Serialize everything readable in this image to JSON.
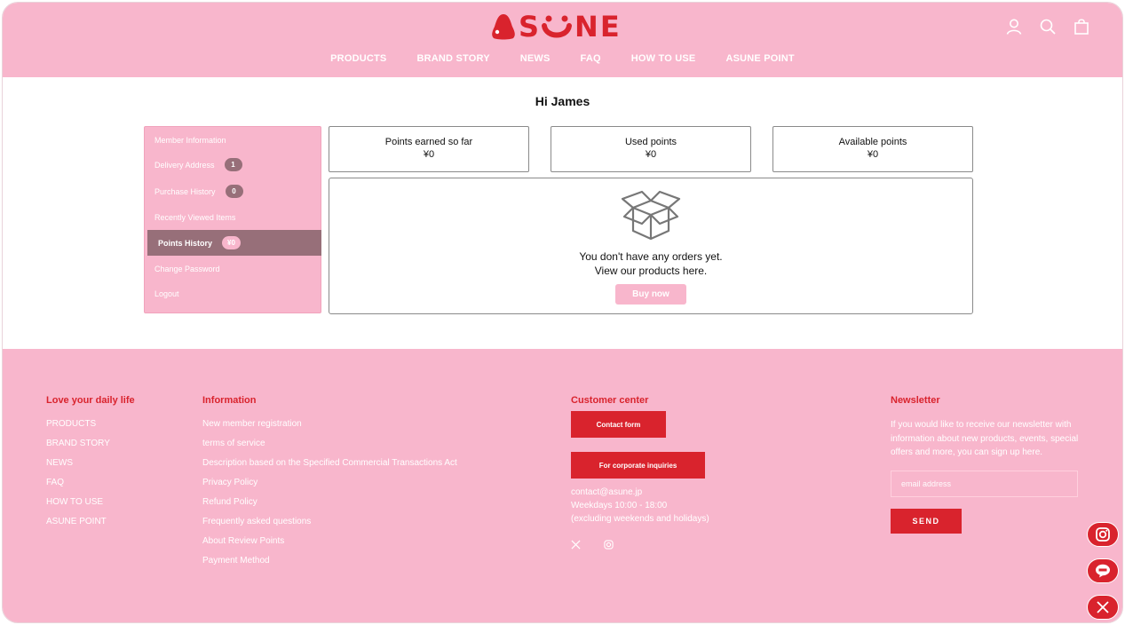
{
  "header": {
    "logo_text": "SNE",
    "logo_full": "ASUNE",
    "nav": [
      "PRODUCTS",
      "BRAND STORY",
      "NEWS",
      "FAQ",
      "HOW TO USE",
      "ASUNE POINT"
    ],
    "icons": [
      "user-icon",
      "search-icon",
      "shopping-bag-icon"
    ]
  },
  "main": {
    "greeting": "Hi James",
    "sidebar": [
      {
        "label": "Member Information",
        "badge": null
      },
      {
        "label": "Delivery Address",
        "badge": "1"
      },
      {
        "label": "Purchase History",
        "badge": "0"
      },
      {
        "label": "Recently Viewed Items",
        "badge": null
      },
      {
        "label": "Points History",
        "badge": "¥0",
        "active": true
      },
      {
        "label": "Change Password",
        "badge": null
      },
      {
        "label": "Logout",
        "badge": null
      }
    ],
    "stats": [
      {
        "label": "Points earned so far",
        "value": "¥0"
      },
      {
        "label": "Used points",
        "value": "¥0"
      },
      {
        "label": "Available points",
        "value": "¥0"
      }
    ],
    "orders": {
      "empty_line1": "You don't have any orders yet.",
      "empty_line2": "View our products here.",
      "button": "Buy now",
      "icon": "open-box-icon"
    }
  },
  "footer": {
    "col1": {
      "heading": "Love your daily life",
      "links": [
        "PRODUCTS",
        "BRAND STORY",
        "NEWS",
        "FAQ",
        "HOW TO USE",
        "ASUNE POINT"
      ]
    },
    "col2": {
      "heading": "Information",
      "links": [
        "New member registration",
        "terms of service",
        "Description based on the Specified Commercial Transactions Act",
        "Privacy Policy",
        "Refund Policy",
        "Frequently asked questions",
        "About Review Points",
        "Payment Method"
      ]
    },
    "col3": {
      "heading": "Customer center",
      "contact_button": "Contact form",
      "corporate_button": "For corporate inquiries",
      "email": "contact@asune.jp",
      "hours": "Weekdays 10:00 - 18:00",
      "hours_note": "(excluding weekends and holidays)",
      "social": [
        "x-icon",
        "instagram-icon"
      ]
    },
    "col4": {
      "heading": "Newsletter",
      "text": "If you would like to receive our newsletter with information about new products, events, special offers and more, you can sign up here.",
      "email_placeholder": "email address",
      "send_label": "SEND"
    }
  },
  "floating_social": [
    "instagram-icon",
    "line-icon",
    "x-icon"
  ],
  "colors": {
    "pink": "#f8b6cc",
    "red": "#d9232d",
    "mauve": "#976f79"
  }
}
